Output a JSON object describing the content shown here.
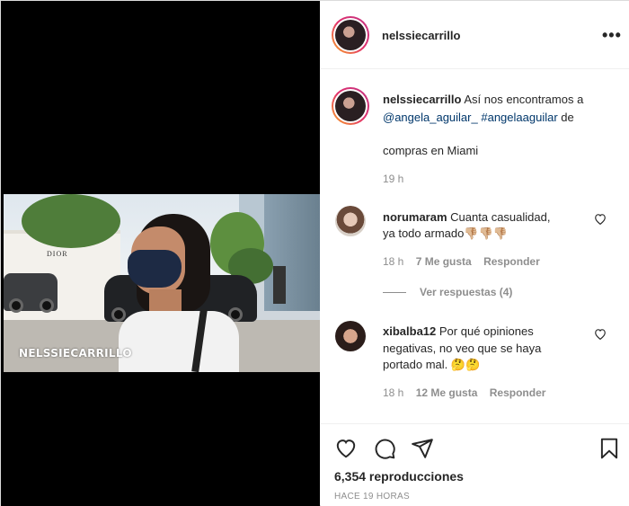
{
  "post": {
    "author": "nelssiecarrillo",
    "video_watermark": "NELSSIECARRILLO",
    "store_sign": "DIOR",
    "caption": {
      "username": "nelssiecarrillo",
      "line1_text": "Así nos encontramos a",
      "mention": "@angela_aguilar_",
      "hashtag": "#angelaaguilar",
      "line2_tail": "de",
      "line3": "compras en Miami",
      "time": "19 h"
    },
    "comments": [
      {
        "username": "norumaram",
        "text_line1": "Cuanta casualidad,",
        "text_line2": "ya todo armado👎🏼👎🏼👎🏼",
        "time": "18 h",
        "likes": "7 Me gusta",
        "reply": "Responder",
        "view_replies": "Ver respuestas (4)"
      },
      {
        "username": "xibalba12",
        "text_line1": "Por qué opiniones",
        "text_line2": "negativas, no veo que se haya",
        "text_line3": "portado mal. 🤔🤔",
        "time": "18 h",
        "likes": "12 Me gusta",
        "reply": "Responder"
      }
    ],
    "views": "6,354 reproducciones",
    "posted_ago": "HACE 19 HORAS"
  },
  "icons": {
    "more": "more-options-icon",
    "like": "heart-icon",
    "comment": "comment-bubble-icon",
    "share": "paper-plane-icon",
    "save": "bookmark-icon"
  },
  "colors": {
    "text": "#262626",
    "muted": "#8e8e8e",
    "link": "#00376b",
    "border": "#dbdbdb"
  }
}
